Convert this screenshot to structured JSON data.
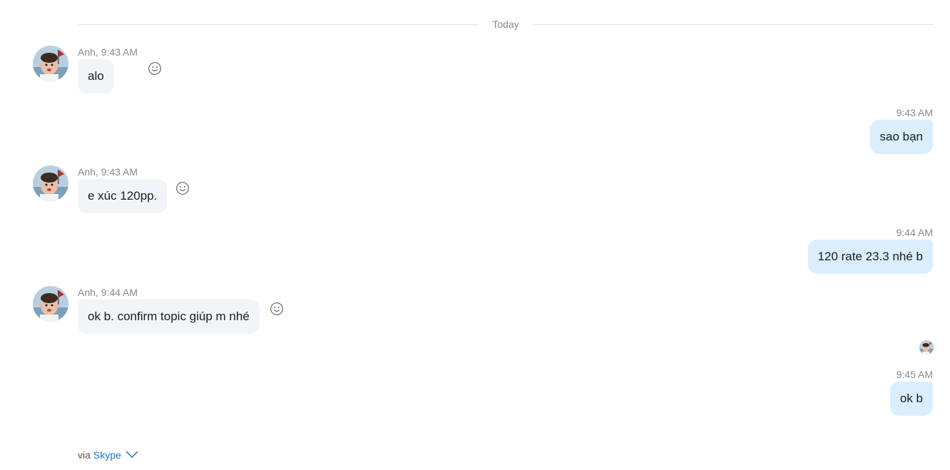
{
  "day_separator": "Today",
  "messages": [
    {
      "direction": "incoming",
      "meta": "Anh, 9:43 AM",
      "text": "alo"
    },
    {
      "direction": "outgoing",
      "meta": "9:43 AM",
      "text": "sao bạn"
    },
    {
      "direction": "incoming",
      "meta": "Anh, 9:43 AM",
      "text": "e xúc 120pp."
    },
    {
      "direction": "outgoing",
      "meta": "9:44 AM",
      "text": "120 rate 23.3 nhé b"
    },
    {
      "direction": "incoming",
      "meta": "Anh, 9:44 AM",
      "text": "ok b. confirm topic giúp m nhé"
    },
    {
      "direction": "outgoing",
      "meta": "9:45 AM",
      "text": "ok b"
    }
  ],
  "footer": {
    "prefix": "via",
    "link": "Skype"
  },
  "colors": {
    "incoming_bubble": "#f2f4f7",
    "outgoing_bubble": "#dbeefd",
    "link": "#1a73c8"
  },
  "icons": {
    "reaction": "smiley-icon",
    "footer_toggle": "chevron-down-icon"
  }
}
